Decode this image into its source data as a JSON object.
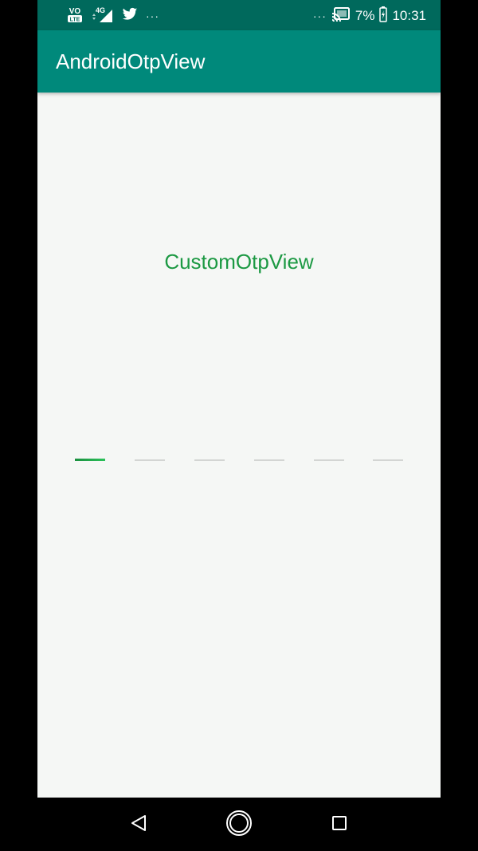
{
  "status_bar": {
    "time": "10:31",
    "battery_percent": "7%",
    "network_label": "4G",
    "volte_label": "VO",
    "lte_label": "LTE",
    "left_overflow": "···",
    "right_overflow": "···",
    "icons": [
      "volte-icon",
      "signal-icon",
      "twitter-icon",
      "cast-icon",
      "battery-icon"
    ]
  },
  "app_bar": {
    "title": "AndroidOtpView"
  },
  "main": {
    "label": "CustomOtpView",
    "label_color": "#1C9943",
    "otp": {
      "length": 6,
      "active_index": 0,
      "active_color": "#2BC25A",
      "inactive_color": "#D3D5D3"
    }
  },
  "nav_bar": {
    "buttons": [
      "back-icon",
      "home-icon",
      "recents-icon"
    ]
  },
  "colors": {
    "status_bar": "#00695C",
    "app_bar": "#00897B",
    "background": "#F5F7F5"
  }
}
